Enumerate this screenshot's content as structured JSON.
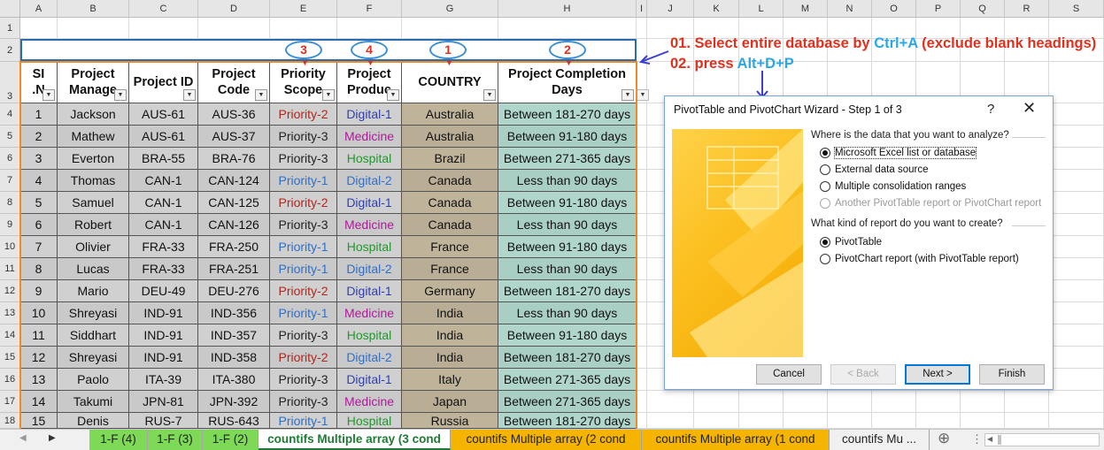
{
  "columns": [
    "A",
    "B",
    "C",
    "D",
    "E",
    "F",
    "G",
    "H",
    "I",
    "J",
    "K",
    "L",
    "M",
    "N",
    "O",
    "P",
    "Q",
    "R",
    "S"
  ],
  "rows": [
    "1",
    "2",
    "3",
    "4",
    "5",
    "6",
    "7",
    "8",
    "9",
    "10",
    "11",
    "12",
    "13",
    "14",
    "15",
    "16",
    "17",
    "18"
  ],
  "headers": [
    {
      "line1": "SI",
      "line2": ".N"
    },
    {
      "line1": "Project",
      "line2": "Manage"
    },
    {
      "line1": "Project ID",
      "line2": ""
    },
    {
      "line1": "Project",
      "line2": "Code"
    },
    {
      "line1": "Priority",
      "line2": "Scope"
    },
    {
      "line1": "Project",
      "line2": "Produc"
    },
    {
      "line1": "COUNTRY",
      "line2": ""
    },
    {
      "line1": "Project Completion",
      "line2": "Days"
    }
  ],
  "circles": [
    "3",
    "4",
    "1",
    "2"
  ],
  "data_rows": [
    [
      "1",
      "Jackson",
      "AUS-61",
      "AUS-36",
      "Priority-2",
      "Digital-1",
      "Australia",
      "Between 181-270 days"
    ],
    [
      "2",
      "Mathew",
      "AUS-61",
      "AUS-37",
      "Priority-3",
      "Medicine",
      "Australia",
      "Between 91-180 days"
    ],
    [
      "3",
      "Everton",
      "BRA-55",
      "BRA-76",
      "Priority-3",
      "Hospital",
      "Brazil",
      "Between 271-365 days"
    ],
    [
      "4",
      "Thomas",
      "CAN-1",
      "CAN-124",
      "Priority-1",
      "Digital-2",
      "Canada",
      "Less than 90 days"
    ],
    [
      "5",
      "Samuel",
      "CAN-1",
      "CAN-125",
      "Priority-2",
      "Digital-1",
      "Canada",
      "Between 91-180 days"
    ],
    [
      "6",
      "Robert",
      "CAN-1",
      "CAN-126",
      "Priority-3",
      "Medicine",
      "Canada",
      "Less than 90 days"
    ],
    [
      "7",
      "Olivier",
      "FRA-33",
      "FRA-250",
      "Priority-1",
      "Hospital",
      "France",
      "Between 91-180 days"
    ],
    [
      "8",
      "Lucas",
      "FRA-33",
      "FRA-251",
      "Priority-1",
      "Digital-2",
      "France",
      "Less than 90 days"
    ],
    [
      "9",
      "Mario",
      "DEU-49",
      "DEU-276",
      "Priority-2",
      "Digital-1",
      "Germany",
      "Between 181-270 days"
    ],
    [
      "10",
      "Shreyasi",
      "IND-91",
      "IND-356",
      "Priority-1",
      "Medicine",
      "India",
      "Less than 90 days"
    ],
    [
      "11",
      "Siddhart",
      "IND-91",
      "IND-357",
      "Priority-3",
      "Hospital",
      "India",
      "Between 91-180 days"
    ],
    [
      "12",
      "Shreyasi",
      "IND-91",
      "IND-358",
      "Priority-2",
      "Digital-2",
      "India",
      "Between 181-270 days"
    ],
    [
      "13",
      "Paolo",
      "ITA-39",
      "ITA-380",
      "Priority-3",
      "Digital-1",
      "Italy",
      "Between 271-365 days"
    ],
    [
      "14",
      "Takumi",
      "JPN-81",
      "JPN-392",
      "Priority-3",
      "Medicine",
      "Japan",
      "Between 271-365 days"
    ],
    [
      "15",
      "Denis",
      "RUS-7",
      "RUS-643",
      "Priority-1",
      "Hospital",
      "Russia",
      "Between 181-270 days"
    ]
  ],
  "colors": {
    "Priority-1": "#2e6fc9",
    "Priority-2": "#b3261e",
    "Priority-3": "#222222",
    "Digital-1": "#2e3fb0",
    "Digital-2": "#2e6fc9",
    "Medicine": "#b0189c",
    "Hospital": "#1f9a2a",
    "table_outline": "#f08a24",
    "annotation_red": "#e0301e",
    "annotation_blue": "#2aa7e6"
  },
  "annotations": {
    "line1_text": "01. Select entire database by ",
    "line1_key": "Ctrl+A",
    "line1_tail": " (exclude blank headings)",
    "line2_text": "02. press ",
    "line2_key": "Alt+D+P"
  },
  "dialog": {
    "title": "PivotTable and PivotChart Wizard - Step 1 of 3",
    "help": "?",
    "close": "✕",
    "q1": "Where is the data that you want to analyze?",
    "opt1": "Microsoft Excel list or database",
    "opt2": "External data source",
    "opt3": "Multiple consolidation ranges",
    "opt4": "Another PivotTable report or PivotChart report",
    "q2": "What kind of report do you want to create?",
    "opt5": "PivotTable",
    "opt6": "PivotChart report (with PivotTable report)",
    "cancel": "Cancel",
    "back": "< Back",
    "next": "Next >",
    "finish": "Finish"
  },
  "tabs": [
    {
      "label": "1-F (4)",
      "color": "#7ed957"
    },
    {
      "label": "1-F (3)",
      "color": "#7ed957"
    },
    {
      "label": "1-F (2)",
      "color": "#7ed957"
    },
    {
      "label": "countifs Multiple array (3 cond",
      "color": "#ffffff",
      "active": true
    },
    {
      "label": "countifs Multiple array (2 cond",
      "color": "#f5b400"
    },
    {
      "label": "countifs Multiple array (1 cond",
      "color": "#f5b400"
    },
    {
      "label": "countifs Mu ...",
      "color": "#f0f0f0"
    }
  ],
  "tab_nav": {
    "prev": "◀",
    "next": "▶",
    "add": "⊕",
    "more": "⋮"
  }
}
